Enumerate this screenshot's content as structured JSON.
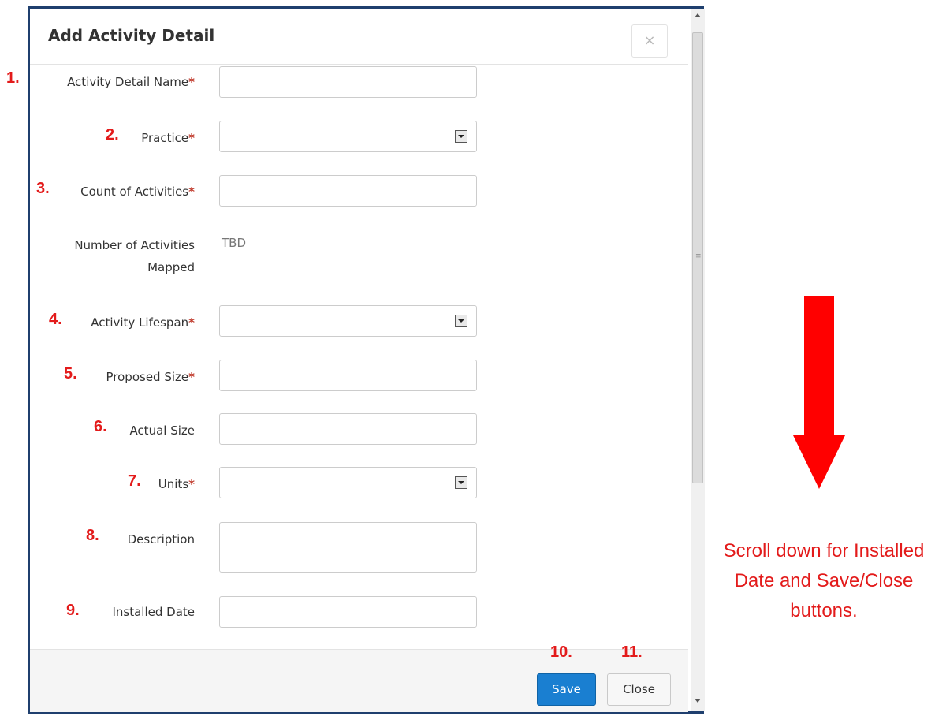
{
  "dialog": {
    "title": "Add Activity Detail",
    "close_icon": "×",
    "scroll_grip": "≡"
  },
  "fields": {
    "activity_detail_name": {
      "number": "1.",
      "label": "Activity Detail Name",
      "required": "*",
      "value": ""
    },
    "practice": {
      "number": "2.",
      "label": "Practice",
      "required": "*",
      "value": ""
    },
    "count_of_activities": {
      "number": "3.",
      "label": "Count of Activities",
      "required": "*",
      "value": ""
    },
    "number_of_activities_mapped": {
      "label": "Number of Activities Mapped",
      "value": "TBD"
    },
    "activity_lifespan": {
      "number": "4.",
      "label": "Activity Lifespan",
      "required": "*",
      "value": ""
    },
    "proposed_size": {
      "number": "5.",
      "label": "Proposed Size",
      "required": "*",
      "value": ""
    },
    "actual_size": {
      "number": "6.",
      "label": "Actual Size",
      "value": ""
    },
    "units": {
      "number": "7.",
      "label": "Units",
      "required": "*",
      "value": ""
    },
    "description": {
      "number": "8.",
      "label": "Description",
      "value": ""
    },
    "installed_date": {
      "number": "9.",
      "label": "Installed Date",
      "value": ""
    }
  },
  "footer": {
    "save_number": "10.",
    "save_label": "Save",
    "close_number": "11.",
    "close_label": "Close"
  },
  "annotation": {
    "note": "Scroll down for Installed Date and Save/Close buttons.",
    "arrow_color": "#ff0000"
  },
  "colors": {
    "frame_border": "#1f3f6e",
    "primary_button": "#1a7fd1",
    "required_marker": "#c0392b",
    "annotation": "#e31b1b"
  }
}
